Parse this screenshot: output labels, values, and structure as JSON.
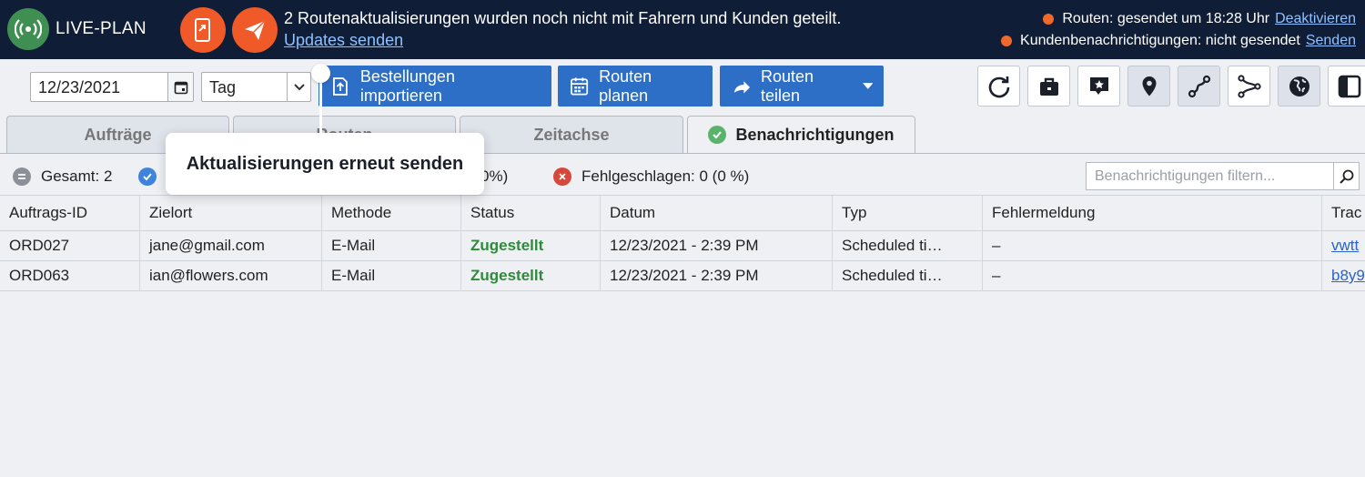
{
  "banner": {
    "app_name": "LIVE-PLAN",
    "message": "2 Routenaktualisierungen wurden noch nicht mit Fahrern und Kunden geteilt.",
    "action_link": "Updates senden",
    "routes_status": "Routen: gesendet um 18:28 Uhr",
    "routes_action": "Deaktivieren",
    "customer_status": "Kundenbenachrichtigungen: nicht gesendet",
    "customer_action": "Senden"
  },
  "toolbar": {
    "date_value": "12/23/2021",
    "view_select": "Tag",
    "import_label": "Bestellungen importieren",
    "plan_label": "Routen planen",
    "share_label": "Routen teilen"
  },
  "tabs": [
    "Aufträge",
    "Routen",
    "Zeitachse",
    "Benachrichtigungen"
  ],
  "summary": {
    "total": "Gesamt: 2",
    "delivered": "0%)",
    "failed": "Fehlgeschlagen: 0 (0 %)",
    "filter_placeholder": "Benachrichtigungen filtern..."
  },
  "table": {
    "columns": [
      "Auftrags-ID",
      "Zielort",
      "Methode",
      "Status",
      "Datum",
      "Typ",
      "Fehlermeldung",
      "Trac"
    ],
    "rows": [
      [
        "ORD027",
        "jane@gmail.com",
        "E-Mail",
        "Zugestellt",
        "12/23/2021 - 2:39 PM",
        "Scheduled ti…",
        "–",
        "vwtt"
      ],
      [
        "ORD063",
        "ian@flowers.com",
        "E-Mail",
        "Zugestellt",
        "12/23/2021 - 2:39 PM",
        "Scheduled ti…",
        "–",
        "b8y9"
      ]
    ]
  },
  "tooltip": {
    "text": "Aktualisierungen erneut senden"
  },
  "colors": {
    "banner_bg": "#0f1d36",
    "accent_orange": "#ef5a28",
    "primary_blue": "#2d6fc6",
    "status_green": "#2f8a3c"
  }
}
